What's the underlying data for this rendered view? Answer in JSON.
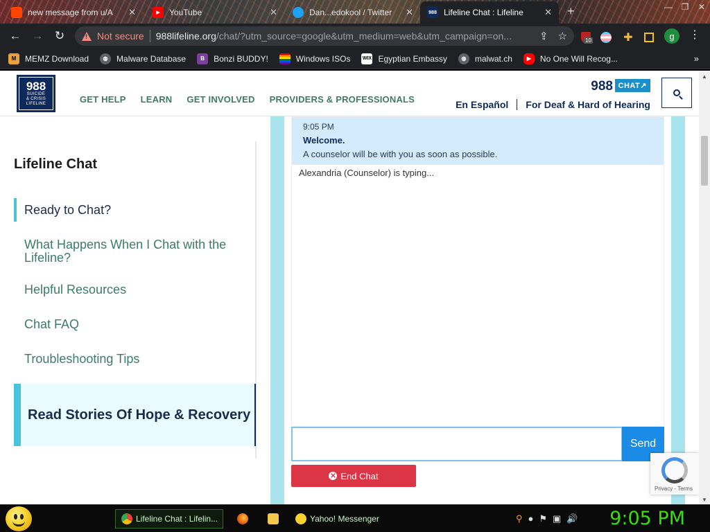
{
  "browser": {
    "tabs": [
      {
        "title": "new message from u/A",
        "icon": "reddit-icon"
      },
      {
        "title": "YouTube",
        "icon": "youtube-icon"
      },
      {
        "title": "Dan...edokool / Twitter",
        "icon": "twitter-icon"
      },
      {
        "title": "Lifeline Chat : Lifeline",
        "icon": "988-icon",
        "active": true
      }
    ],
    "security_label": "Not secure",
    "url_host": "988lifeline.org",
    "url_rest": "/chat/?utm_source=google&utm_medium=web&utm_campaign=on...",
    "ublock_count": "10",
    "profile_initial": "g",
    "bookmarks": [
      {
        "label": "MEMZ Download",
        "icon": "globe-icon"
      },
      {
        "label": "Malware Database",
        "icon": "globe-icon"
      },
      {
        "label": "Bonzi BUDDY!",
        "icon": "bonzi-icon"
      },
      {
        "label": "Windows ISOs",
        "icon": "rainbow-icon"
      },
      {
        "label": "Egyptian Embassy",
        "icon": "wix-icon"
      },
      {
        "label": "malwat.ch",
        "icon": "globe-icon"
      },
      {
        "label": "No One Will Recog...",
        "icon": "youtube-icon"
      }
    ]
  },
  "site": {
    "logo_number": "988",
    "logo_lines": [
      "SUICIDE",
      "& CRISIS",
      "LIFELINE"
    ],
    "nav": [
      "GET HELP",
      "LEARN",
      "GET INVOLVED",
      "PROVIDERS & PROFESSIONALS"
    ],
    "brand": "988",
    "chat_badge": "CHAT↗",
    "lang_link": "En Español",
    "deaf_link": "For Deaf & Hard of Hearing"
  },
  "sidebar": {
    "title": "Lifeline Chat",
    "items": [
      "Ready to Chat?",
      "What Happens When I Chat with the Lifeline?",
      "Helpful Resources",
      "Chat FAQ",
      "Troubleshooting Tips"
    ],
    "stories": "Read Stories Of Hope & Recovery"
  },
  "chat": {
    "message": {
      "time": "9:05 PM",
      "sender": "Welcome.",
      "text": "A counselor will be with you as soon as possible."
    },
    "typing": "Alexandria (Counselor) is typing...",
    "input_value": "",
    "send_label": "Send",
    "end_label": "End Chat"
  },
  "recaptcha": {
    "text": "Privacy - Terms"
  },
  "taskbar": {
    "tasks": [
      "Lifeline Chat : Lifelin...",
      "Yahoo! Messenger"
    ],
    "clock": "9:05 PM"
  },
  "colors": {
    "accent_teal": "#4cc3dc",
    "nav_green": "#3e7a6a",
    "navy": "#0e2a5c",
    "send_blue": "#1a8ce8",
    "end_red": "#dc3545",
    "clock_green": "#36e000"
  }
}
